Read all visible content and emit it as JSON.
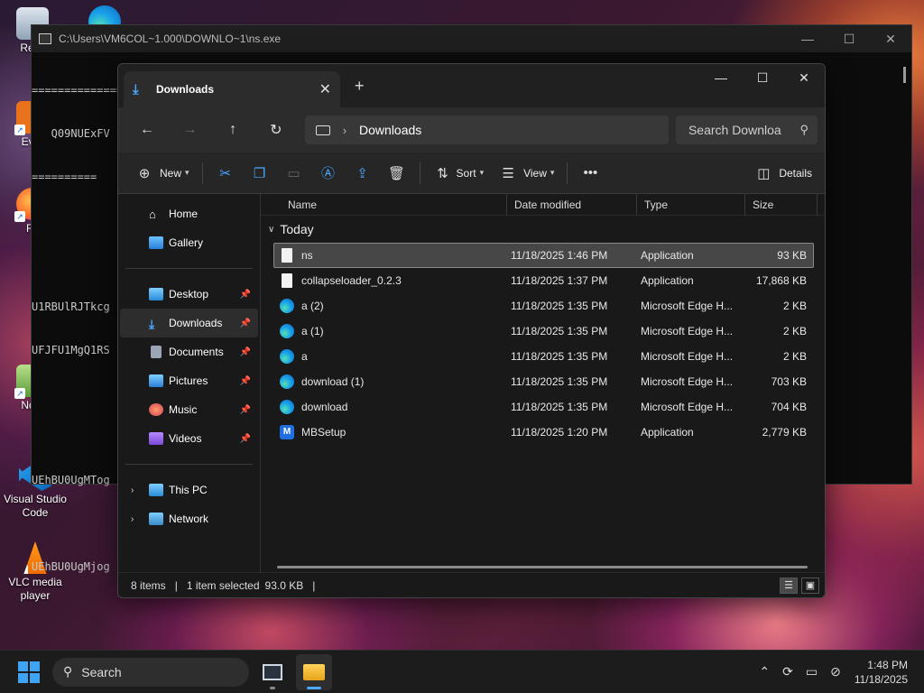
{
  "desktop": {
    "icons": [
      {
        "label": "Recy"
      },
      {
        "label": "Ever"
      },
      {
        "label": "Fir"
      },
      {
        "label": "Note"
      },
      {
        "label": "Visual Studio Code"
      },
      {
        "label": "VLC media player"
      }
    ]
  },
  "console": {
    "title": "C:\\Users\\VM6COL~1.000\\DOWNLO~1\\ns.exe",
    "lines": [
      "==========================================",
      "   Q09NUExFV",
      "==========",
      "",
      "",
      "U1RBUlRJTkcg",
      "UFJFU1MgQ1RS",
      "",
      "",
      "UEhBU0UgMTog",
      "",
      "UEhBU0UgMjog"
    ]
  },
  "explorer": {
    "tab_title": "Downloads",
    "address": "Downloads",
    "search_placeholder": "Search Downloa",
    "toolbar": {
      "new_label": "New",
      "sort_label": "Sort",
      "view_label": "View",
      "details_label": "Details"
    },
    "nav": {
      "home": "Home",
      "gallery": "Gallery",
      "desktop": "Desktop",
      "downloads": "Downloads",
      "documents": "Documents",
      "pictures": "Pictures",
      "music": "Music",
      "videos": "Videos",
      "this_pc": "This PC",
      "network": "Network"
    },
    "columns": {
      "name": "Name",
      "date": "Date modified",
      "type": "Type",
      "size": "Size"
    },
    "group_label": "Today",
    "files": [
      {
        "name": "ns",
        "date": "11/18/2025 1:46 PM",
        "type": "Application",
        "size": "93 KB",
        "icon": "file-icon"
      },
      {
        "name": "collapseloader_0.2.3",
        "date": "11/18/2025 1:37 PM",
        "type": "Application",
        "size": "17,868 KB",
        "icon": "file-icon"
      },
      {
        "name": "a (2)",
        "date": "11/18/2025 1:35 PM",
        "type": "Microsoft Edge H...",
        "size": "2 KB",
        "icon": "edge-icon"
      },
      {
        "name": "a (1)",
        "date": "11/18/2025 1:35 PM",
        "type": "Microsoft Edge H...",
        "size": "2 KB",
        "icon": "edge-icon"
      },
      {
        "name": "a",
        "date": "11/18/2025 1:35 PM",
        "type": "Microsoft Edge H...",
        "size": "2 KB",
        "icon": "edge-icon"
      },
      {
        "name": "download (1)",
        "date": "11/18/2025 1:35 PM",
        "type": "Microsoft Edge H...",
        "size": "703 KB",
        "icon": "edge-icon"
      },
      {
        "name": "download",
        "date": "11/18/2025 1:35 PM",
        "type": "Microsoft Edge H...",
        "size": "704 KB",
        "icon": "edge-icon"
      },
      {
        "name": "MBSetup",
        "date": "11/18/2025 1:20 PM",
        "type": "Application",
        "size": "2,779 KB",
        "icon": "malwarebytes-icon"
      }
    ],
    "status": {
      "items": "8 items",
      "selected": "1 item selected",
      "size": "93.0 KB"
    }
  },
  "taskbar": {
    "search_label": "Search",
    "time": "1:48 PM",
    "date": "11/18/2025"
  }
}
